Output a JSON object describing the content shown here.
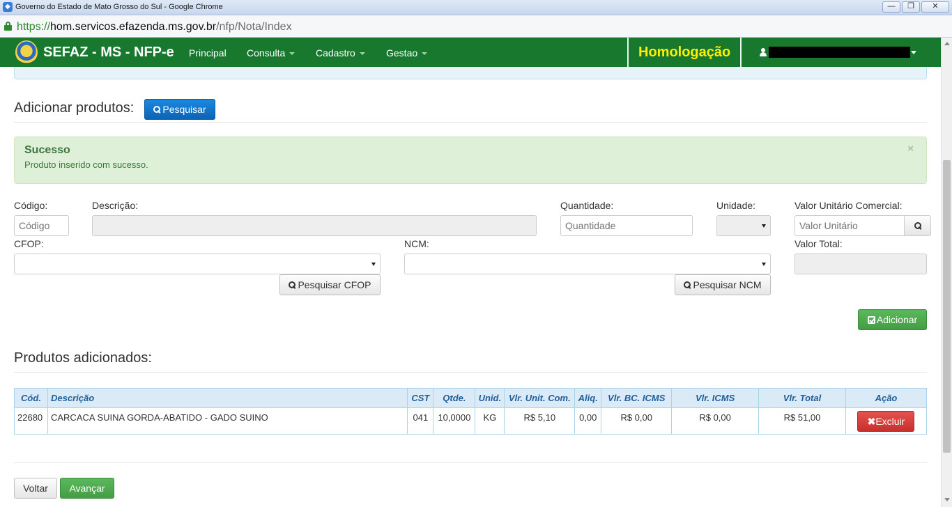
{
  "window": {
    "title": "Governo do Estado de Mato Grosso do Sul - Google Chrome",
    "controls": {
      "minimize": "—",
      "maximize": "❐",
      "close": "✕"
    }
  },
  "browser": {
    "url_scheme": "https://",
    "url_host": "hom.servicos.efazenda.ms.gov.br",
    "url_path": "/nfp/Nota/Index"
  },
  "navbar": {
    "brand": "SEFAZ - MS - NFP-e",
    "links": [
      "Principal",
      "Consulta",
      "Cadastro",
      "Gestao"
    ],
    "environment": "Homologação",
    "colors": {
      "bar": "#18782e",
      "environment_text": "#ffee00"
    }
  },
  "add_products": {
    "title": "Adicionar produtos:",
    "search_button": "Pesquisar"
  },
  "alert": {
    "title": "Sucesso",
    "message": "Produto inserido com sucesso.",
    "close": "×"
  },
  "form": {
    "codigo_label": "Código:",
    "codigo_placeholder": "Código",
    "descricao_label": "Descrição:",
    "quantidade_label": "Quantidade:",
    "quantidade_placeholder": "Quantidade",
    "unidade_label": "Unidade:",
    "valor_unitario_label": "Valor Unitário Comercial:",
    "valor_unitario_placeholder": "Valor Unitário",
    "cfop_label": "CFOP:",
    "ncm_label": "NCM:",
    "valor_total_label": "Valor Total:",
    "pesquisar_cfop": "Pesquisar CFOP",
    "pesquisar_ncm": "Pesquisar NCM",
    "adicionar": "Adicionar"
  },
  "products": {
    "title": "Produtos adicionados:",
    "columns": [
      "Cód.",
      "Descrição",
      "CST",
      "Qtde.",
      "Unid.",
      "Vlr. Unit. Com.",
      "Aliq.",
      "Vlr. BC. ICMS",
      "Vlr. ICMS",
      "Vlr. Total",
      "Ação"
    ],
    "rows": [
      {
        "cod": "22680",
        "descricao": "CARCACA SUINA GORDA-ABATIDO - GADO SUINO",
        "cst": "041",
        "qtde": "10,0000",
        "unid": "KG",
        "vlr_unit": "R$ 5,10",
        "aliq": "0,00",
        "vlr_bc_icms": "R$ 0,00",
        "vlr_icms": "R$ 0,00",
        "vlr_total": "R$ 51,00",
        "acao": "Excluir"
      }
    ]
  },
  "footer": {
    "voltar": "Voltar",
    "avancar": "Avançar"
  }
}
